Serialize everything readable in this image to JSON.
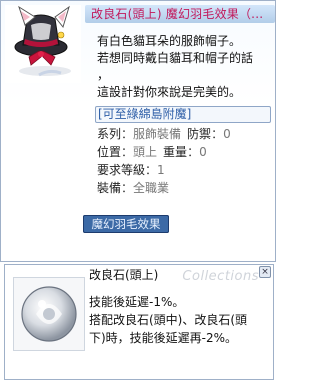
{
  "item": {
    "title": "改良石(頭上) 魔幻羽毛效果（...",
    "description": [
      "有白色貓耳朵的服飾帽子。",
      "若想同時戴白貓耳和帽子的話",
      "，",
      "這設計對你來說是完美的。"
    ],
    "link": "[可至綠綿島附魔]",
    "properties": [
      {
        "key": "系列",
        "value": "服飾裝備",
        "key2": "防禦",
        "value2": "0"
      },
      {
        "key": "位置",
        "value": "頭上",
        "key2": "重量",
        "value2": "0"
      },
      {
        "key": "要求等級",
        "value": "1"
      },
      {
        "key": "裝備",
        "value": "全職業"
      }
    ],
    "separator": "：",
    "name_tab": "魔幻羽毛效果"
  },
  "card": {
    "title": "改良石(頭上)",
    "watermark": "Collections",
    "close_label": "×",
    "description": [
      "技能後延遲-1%。",
      "搭配改良石(頭中)、改良石(頭",
      "下)時，技能後延遲再-2%。"
    ]
  },
  "colors": {
    "title_text": "#c2185b",
    "name_tab_bg": "#3c6aa6",
    "link_text": "#2f5fa8"
  },
  "icons": {
    "item_icon": "white-cat-ear-hat-icon",
    "card_icon": "enchant-stone-icon",
    "slot_card": "card-slot-icon",
    "slot_gem": "empty-slot-icon"
  }
}
